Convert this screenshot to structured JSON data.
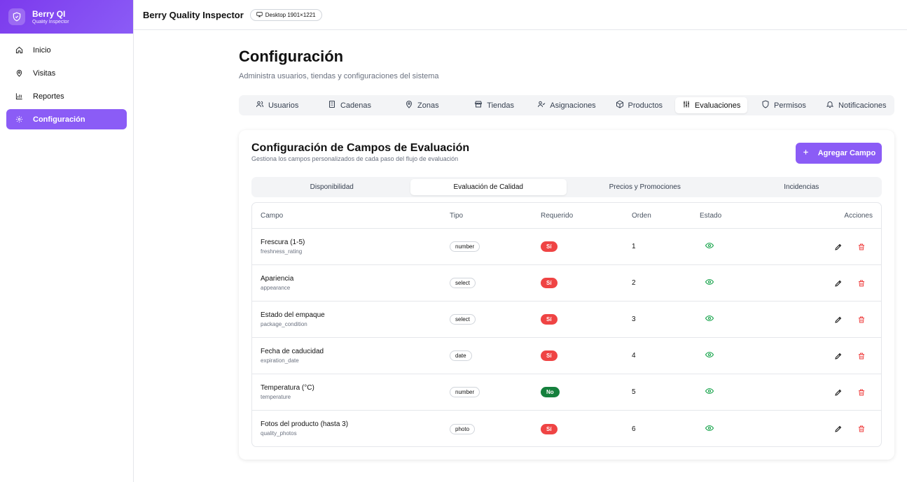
{
  "brand": {
    "title": "Berry QI",
    "subtitle": "Quality Inspector"
  },
  "sidebar": {
    "items": [
      {
        "label": "Inicio",
        "icon": "home-icon",
        "active": false
      },
      {
        "label": "Visitas",
        "icon": "map-pin-icon",
        "active": false
      },
      {
        "label": "Reportes",
        "icon": "bar-chart-icon",
        "active": false
      },
      {
        "label": "Configuración",
        "icon": "gear-icon",
        "active": true
      }
    ]
  },
  "header": {
    "title": "Berry Quality Inspector",
    "device_badge": "Desktop 1901×1221"
  },
  "page": {
    "title": "Configuración",
    "subtitle": "Administra usuarios, tiendas y configuraciones del sistema"
  },
  "tabs": [
    {
      "label": "Usuarios",
      "icon": "users-icon"
    },
    {
      "label": "Cadenas",
      "icon": "building-icon"
    },
    {
      "label": "Zonas",
      "icon": "map-pin-icon"
    },
    {
      "label": "Tiendas",
      "icon": "store-icon"
    },
    {
      "label": "Asignaciones",
      "icon": "user-check-icon"
    },
    {
      "label": "Productos",
      "icon": "box-icon"
    },
    {
      "label": "Evaluaciones",
      "icon": "sliders-icon",
      "active": true
    },
    {
      "label": "Permisos",
      "icon": "shield-icon"
    },
    {
      "label": "Notificaciones",
      "icon": "bell-icon"
    }
  ],
  "card": {
    "title": "Configuración de Campos de Evaluación",
    "description": "Gestiona los campos personalizados de cada paso del flujo de evaluación",
    "add_button": "Agregar Campo"
  },
  "subtabs": [
    {
      "label": "Disponibilidad"
    },
    {
      "label": "Evaluación de Calidad",
      "active": true
    },
    {
      "label": "Precios y Promociones"
    },
    {
      "label": "Incidencias"
    }
  ],
  "table": {
    "headers": {
      "campo": "Campo",
      "tipo": "Tipo",
      "requerido": "Requerido",
      "orden": "Orden",
      "estado": "Estado",
      "acciones": "Acciones"
    },
    "rows": [
      {
        "name": "Frescura (1-5)",
        "key": "freshness_rating",
        "type": "number",
        "required": "Sí",
        "order": "1"
      },
      {
        "name": "Apariencia",
        "key": "appearance",
        "type": "select",
        "required": "Sí",
        "order": "2"
      },
      {
        "name": "Estado del empaque",
        "key": "package_condition",
        "type": "select",
        "required": "Sí",
        "order": "3"
      },
      {
        "name": "Fecha de caducidad",
        "key": "expiration_date",
        "type": "date",
        "required": "Sí",
        "order": "4"
      },
      {
        "name": "Temperatura (°C)",
        "key": "temperature",
        "type": "number",
        "required": "No",
        "order": "5"
      },
      {
        "name": "Fotos del producto (hasta 3)",
        "key": "quality_photos",
        "type": "photo",
        "required": "Sí",
        "order": "6"
      }
    ]
  },
  "colors": {
    "accent": "#8b5cf6",
    "required_yes": "#ef4444",
    "required_no": "#15803d",
    "visible_eye": "#16a34a",
    "delete": "#ef4444"
  }
}
